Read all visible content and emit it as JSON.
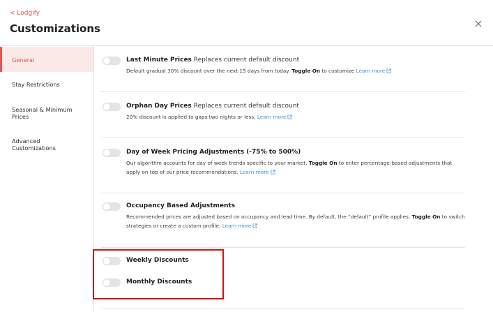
{
  "header": {
    "back_link": "< Lodgify",
    "title": "Customizations",
    "close_icon": "close-icon"
  },
  "sidebar": {
    "items": [
      {
        "label": "General",
        "active": true
      },
      {
        "label": "Stay Restrictions",
        "active": false
      },
      {
        "label": "Seasonal & Minimum Prices",
        "active": false
      },
      {
        "label": "Advanced Customizations",
        "active": false
      }
    ]
  },
  "settings": [
    {
      "title": "Last Minute Prices",
      "subtitle": "Replaces current default discount",
      "desc_before": "Default gradual 30% discount over the next 15 days from today. ",
      "desc_bold": "Toggle On",
      "desc_after": " to customize ",
      "learn_more": "Learn more",
      "enabled": false
    },
    {
      "title": "Orphan Day Prices",
      "subtitle": "Replaces current default discount",
      "desc_before": "20% discount is applied to gaps two nights or less. ",
      "learn_more": "Learn more",
      "enabled": false
    },
    {
      "title": "Day of Week Pricing Adjustments (-75% to 500%)",
      "desc_before": "Our algorithm accounts for day of week trends specific to your market. ",
      "desc_bold": "Toggle On",
      "desc_after": " to enter percentage-based adjustments that apply on top of our price recommendations. ",
      "learn_more": "Learn more",
      "enabled": false
    },
    {
      "title": "Occupancy Based Adjustments",
      "desc_before": "Recommended prices are adjusted based on occupancy and lead time. By default, the “default” profile applies. ",
      "desc_bold": "Toggle On",
      "desc_after": " to switch strategies or create a custom profile. ",
      "learn_more": "Learn more",
      "enabled": false
    },
    {
      "title": "Weekly Discounts",
      "enabled": false
    },
    {
      "title": "Monthly Discounts",
      "enabled": false
    }
  ],
  "colors": {
    "accent": "#e25a52",
    "link": "#3b8ee6",
    "highlight_box": "#d41111"
  },
  "icons": {
    "external_link": "external-link-icon"
  }
}
